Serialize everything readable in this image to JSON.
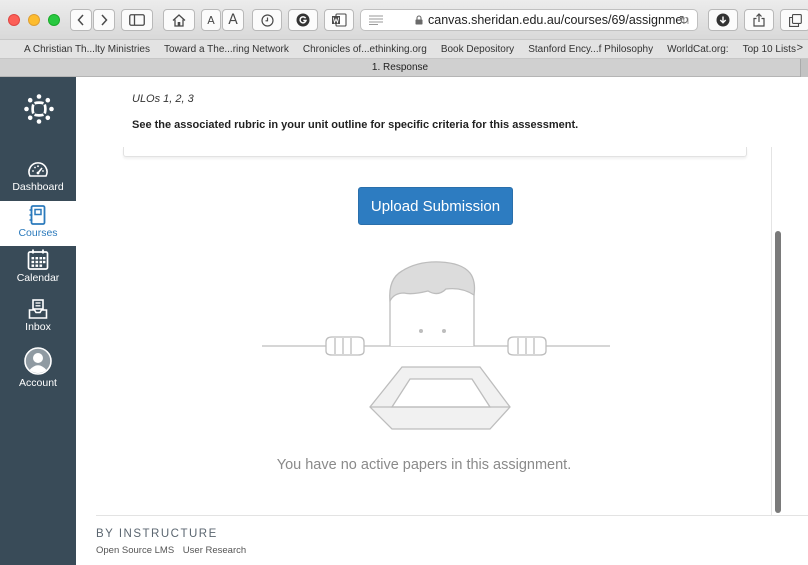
{
  "browser": {
    "url_main": "canvas.sheridan.edu.au/courses/69/assignme",
    "url_faded": "n",
    "reader_label_small": "A",
    "reader_label_large": "A",
    "bookmarks": [
      "A Christian Th...lty Ministries",
      "Toward a The...ring Network",
      "Chronicles of...ethinking.org",
      "Book Depository",
      "Stanford Ency...f Philosophy",
      "WorldCat.org:",
      "Top 10 Lists"
    ],
    "bookmarks_more": ">",
    "tab_title": "1. Response"
  },
  "nav": {
    "items": [
      {
        "label": "Dashboard"
      },
      {
        "label": "Courses"
      },
      {
        "label": "Calendar"
      },
      {
        "label": "Inbox"
      },
      {
        "label": "Account"
      }
    ]
  },
  "assignment": {
    "ulos": "ULOs 1, 2, 3",
    "rubric_note": "See the associated rubric in your unit outline for specific criteria for this assessment."
  },
  "submission": {
    "upload_label": "Upload Submission",
    "empty_message": "You have no active papers in this assignment."
  },
  "footer": {
    "brand": "BY INSTRUCTURE",
    "links": [
      "Open Source LMS",
      "User Research"
    ]
  },
  "colors": {
    "nav_bg": "#394b58",
    "accent": "#2d7cc1",
    "active_nav_text": "#2b7abc"
  }
}
